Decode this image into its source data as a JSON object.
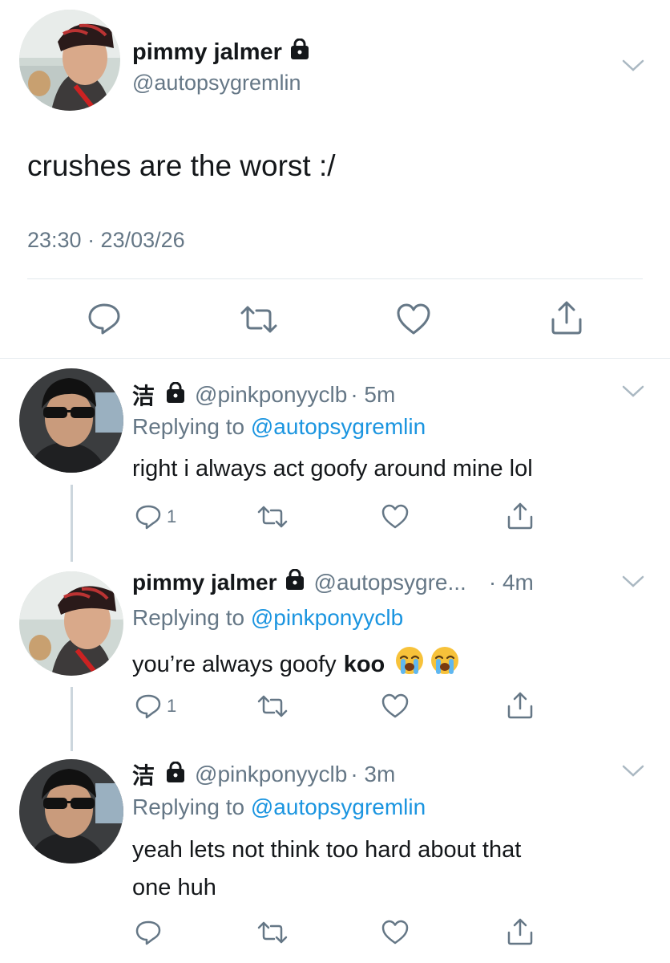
{
  "main_tweet": {
    "name": "pimmy jalmer",
    "handle": "@autopsygremlin",
    "text": "crushes are the worst :/",
    "timestamp": "23:30 · 23/03/26",
    "icons": [
      "reply-icon",
      "retweet-icon",
      "like-icon",
      "share-icon"
    ]
  },
  "replies": [
    {
      "name": "洁",
      "handle": "@pinkponyyclb",
      "time": "· 5m",
      "replying_prefix": "Replying to",
      "replying_to": "@autopsygremlin",
      "text": "right i always act goofy around mine lol",
      "reply_count": "1"
    },
    {
      "name": "pimmy jalmer",
      "handle": "@autopsygre...",
      "time": "· 4m",
      "replying_prefix": "Replying to",
      "replying_to": "@pinkponyyclb",
      "text": "you’re always goofy",
      "text_bold": "koo",
      "emoji": [
        "loudly-crying-face",
        "loudly-crying-face"
      ],
      "reply_count": "1"
    },
    {
      "name": "洁",
      "handle": "@pinkponyyclb",
      "time": "· 3m",
      "replying_prefix": "Replying to",
      "replying_to": "@autopsygremlin",
      "text_line1": "yeah lets not think too hard about that",
      "text_line2": "one huh"
    }
  ],
  "colors": {
    "text": "#14171a",
    "secondary": "#657786",
    "link": "#1b95e0",
    "divider": "#e1e8ed",
    "thread_line": "#ccd6dd"
  }
}
